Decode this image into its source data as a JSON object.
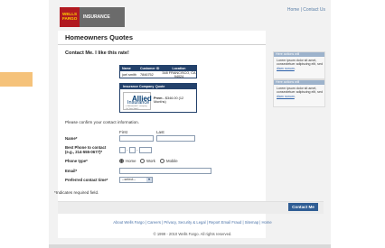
{
  "header": {
    "logo_line1": "WELLS",
    "logo_line2": "FARGO",
    "logo_suffix": "INSURANCE",
    "toplinks": "Home | Contact Us"
  },
  "page": {
    "title": "Homeowners Quotes",
    "subtitle": "Contact Me. I like this rate!"
  },
  "summary_table": {
    "headers": [
      "Name",
      "Customer ID",
      "Location"
    ],
    "row": [
      "joel smith",
      "7846752",
      "348 FRANCISCO, CA 94024"
    ]
  },
  "quote_table": {
    "headers": [
      "Insurance Company",
      "Quote"
    ],
    "company_name": "Allied",
    "company_sub": "Insurance",
    "company_tag": "a Nationwide® company",
    "company_tag2": "On Your Side®",
    "premium_label": "Prem -",
    "premium_value": "$346.00 (12 Months)"
  },
  "sidebar": [
    {
      "heading": "Here actions will",
      "body": "Lorem ipsum dolor sit amet, consectetuer adipiscing elit, sed",
      "link": "diam nonum"
    },
    {
      "heading": "Here actions will",
      "body": "Lorem ipsum dolor sit amet, consectetuer adipiscing elit, sed",
      "link": "diam nonum"
    }
  ],
  "form": {
    "intro": "Please confirm your contact information.",
    "first_label": "First",
    "last_label": "Last",
    "name_label": "Name*",
    "phone_label_1": "Best Phone to contact",
    "phone_label_2": "(e.g., 214-555-0677)*",
    "phone_type_label": "Phone type*",
    "phone_types": [
      "Home",
      "Work",
      "Mobile"
    ],
    "phone_type_selected": "Home",
    "email_label": "Email*",
    "time_label": "Preferred contact time*",
    "time_select": "--select--",
    "required_note": "*Indicates required field.",
    "submit_label": "Contact Me"
  },
  "footer": {
    "links": "About Wells Fargo | Careers | Privacy, Security & Legal | Report Email Fraud | Sitemap | Home",
    "copyright": "© 1999 - 2010 Wells Fargo. All rights reserved."
  },
  "colors": {
    "brand_red": "#b11a21",
    "brand_gold": "#ffd200",
    "table_navy": "#23416b",
    "button_blue": "#2f5d94",
    "accent_orange": "#f5c27a"
  }
}
